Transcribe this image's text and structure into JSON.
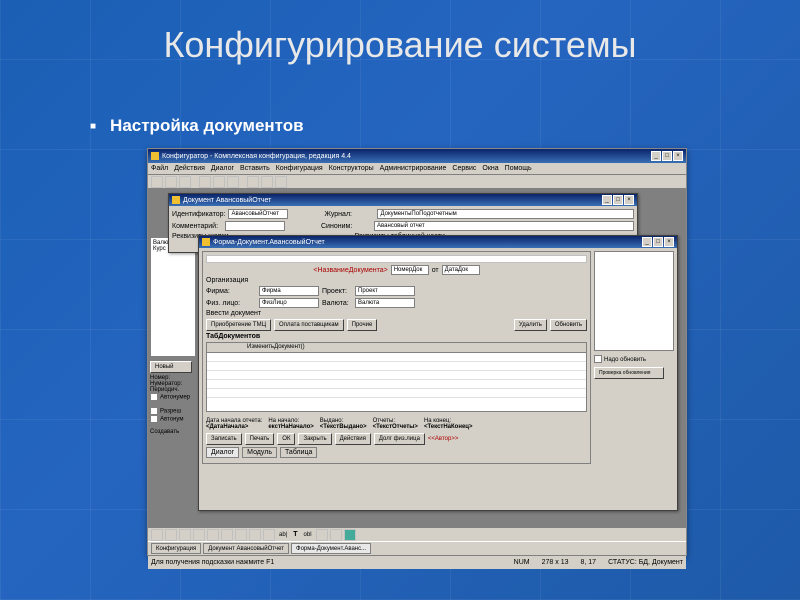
{
  "slide": {
    "title": "Конфигурирование системы",
    "bullet": "Настройка документов"
  },
  "main_window": {
    "title": "Конфигуратор - Комплексная конфигурация, редакция 4.4",
    "menu": [
      "Файл",
      "Действия",
      "Диалог",
      "Вставить",
      "Конфигурация",
      "Конструкторы",
      "Администрирование",
      "Сервис",
      "Окна",
      "Помощь"
    ]
  },
  "doc_window": {
    "title": "Документ АвансовыйОтчет",
    "id_label": "Идентификатор:",
    "id_value": "АвансовыйОтчет",
    "journal_label": "Журнал:",
    "journal_value": "ДокументыПоПодотчетным",
    "comment_label": "Комментарий:",
    "synonym_label": "Синоним:",
    "synonym_value": "Авансовый отчет",
    "header_reqs": "Реквизиты шапки",
    "table_reqs": "Реквизиты табличной части",
    "new_btn": "Новый",
    "left_labels": {
      "nomer": "Номер:",
      "numerator": "Нумератор:",
      "period": "Периодич.",
      "avtonumer": "Автонумер",
      "razresh": "Разреш",
      "avtonum2": "Автонум",
      "sozd": "Создавать"
    }
  },
  "side": {
    "items": [
      "Валюта",
      "Курс"
    ]
  },
  "form_window": {
    "title": "Форма-Документ.АвансовыйОтчет",
    "placeholder": "<НазваниеДокумента>",
    "nomer_lbl": "НомерДок",
    "ot": "от",
    "date_lbl": "ДатаДок",
    "org_lbl": "Организация",
    "firma_lbl": "Фирма:",
    "firma_val": "Фирма",
    "proekt_lbl": "Проект:",
    "proekt_val": "Проект",
    "fiz_lbl": "Физ. лицо:",
    "fiz_val": "ФизЛицо",
    "valuta_lbl": "Валюта:",
    "valuta_val": "Валюта",
    "vvesti": "Ввести документ",
    "tab1": "Приобретение ТМЦ",
    "tab2": "Оплата поставщикам",
    "tab3": "Прочие",
    "udalit": "Удалить",
    "obnovit": "Обновить",
    "nado": "Надо обновить",
    "proverka": "Проверка обновления",
    "tabdoc": "ТабДокументов",
    "izmenit": "ИзменитьДокумент()",
    "footer": {
      "date_start_lbl": "Дата начала отчета:",
      "date_start_val": "<ДатаНачала>",
      "na_nachalo_lbl": "На начало:",
      "na_nachalo_val": "екстНаНачало>",
      "vydano_lbl": "Выдано:",
      "vydano_val": "<ТекстВыдано>",
      "otchety_lbl": "Отчеты:",
      "otchety_val": "<ТекстОтчеты>",
      "na_konec_lbl": "На конец:",
      "na_konec_val": "<ТекстНаКонец>"
    },
    "buttons": {
      "zapisat": "Записать",
      "pechat": "Печать",
      "ok": "ОК",
      "zakryt": "Закрыть",
      "deistviya": "Действия",
      "dolg": "Долг физ.лица",
      "avtor": "<<Автор>>"
    },
    "tabs_bottom": [
      "Диалог",
      "Модуль",
      "Таблица"
    ]
  },
  "taskbar": {
    "items": [
      "Конфигурация",
      "Документ АвансовыйОтчет",
      "Форма-Документ.Аванс..."
    ]
  },
  "statusbar": {
    "hint": "Для получения подсказки нажмите F1",
    "num": "NUM",
    "pos": "278 x 13",
    "sz": "8, 17",
    "status": "СТАТУС: БД, Документ"
  }
}
